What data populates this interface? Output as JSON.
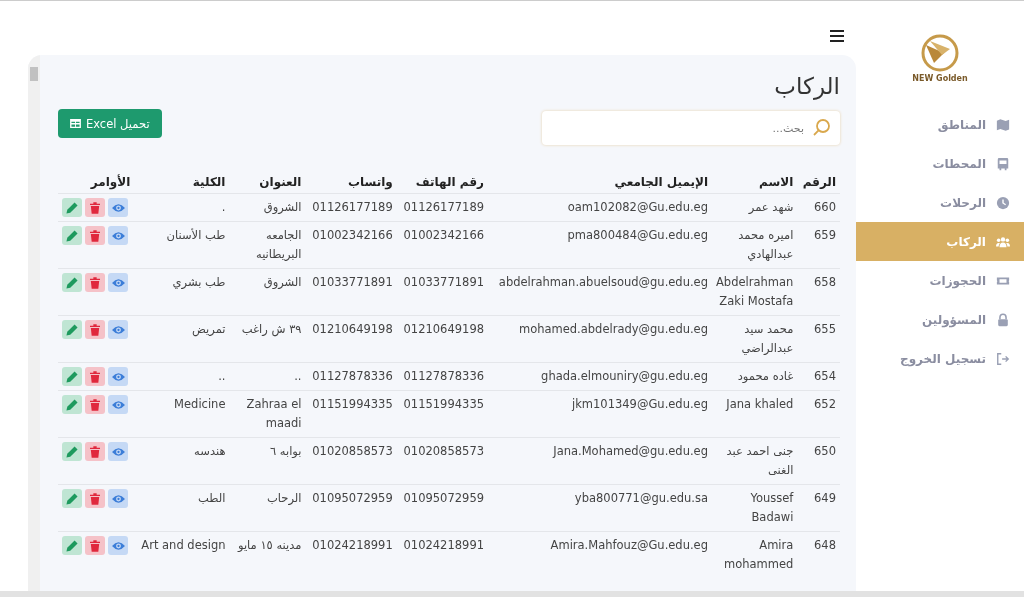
{
  "logo": {
    "text": "NEW Golden"
  },
  "sidebar": {
    "items": [
      {
        "label": "المناطق",
        "selected": false
      },
      {
        "label": "المحطات",
        "selected": false
      },
      {
        "label": "الرحلات",
        "selected": false
      },
      {
        "label": "الركاب",
        "selected": true
      },
      {
        "label": "الحجوزات",
        "selected": false
      },
      {
        "label": "المسؤولين",
        "selected": false
      },
      {
        "label": "تسجيل الخروج",
        "selected": false
      }
    ]
  },
  "page": {
    "title": "الركاب"
  },
  "search": {
    "placeholder": "بحث..."
  },
  "export_button": {
    "label": "تحميل Excel"
  },
  "table": {
    "columns": [
      "الرقم",
      "الاسم",
      "الإيميل الجامعي",
      "رقم الهاتف",
      "واتساب",
      "العنوان",
      "الكلية",
      "الأوامر"
    ],
    "rows": [
      {
        "id": "660",
        "name": "شهد عمر",
        "email": "oam102082@Gu.edu.eg",
        "phone": "01126177189",
        "whatsapp": "01126177189",
        "address": "الشروق",
        "college": "."
      },
      {
        "id": "659",
        "name": "اميره محمد عبدالهادي",
        "email": "pma800484@Gu.edu.eg",
        "phone": "01002342166",
        "whatsapp": "01002342166",
        "address": "الجامعه البريطانيه",
        "college": "طب الأسنان"
      },
      {
        "id": "658",
        "name": "Abdelrahman Zaki Mostafa",
        "email": "abdelrahman.abuelsoud@gu.edu.eg",
        "phone": "01033771891",
        "whatsapp": "01033771891",
        "address": "الشروق",
        "college": "طب بشري"
      },
      {
        "id": "655",
        "name": "محمد سيد عبدالراضي",
        "email": "mohamed.abdelrady@gu.edu.eg",
        "phone": "01210649198",
        "whatsapp": "01210649198",
        "address": "٣٩ ش راغب",
        "college": "تمريض"
      },
      {
        "id": "654",
        "name": "غاده محمود",
        "email": "ghada.elmouniry@gu.edu.eg",
        "phone": "01127878336",
        "whatsapp": "01127878336",
        "address": "..",
        "college": ".."
      },
      {
        "id": "652",
        "name": "Jana khaled",
        "email": "jkm101349@Gu.edu.eg",
        "phone": "01151994335",
        "whatsapp": "01151994335",
        "address": "Zahraa el maadi",
        "college": "Medicine"
      },
      {
        "id": "650",
        "name": "جنى احمد عبد الغنى",
        "email": "Jana.Mohamed@gu.edu.eg",
        "phone": "01020858573",
        "whatsapp": "01020858573",
        "address": "بوابه ٦",
        "college": "هندسه"
      },
      {
        "id": "649",
        "name": "Youssef Badawi",
        "email": "yba800771@gu.edu.sa",
        "phone": "01095072959",
        "whatsapp": "01095072959",
        "address": "الرحاب",
        "college": "الطب"
      },
      {
        "id": "648",
        "name": "Amira mohammed",
        "email": "Amira.Mahfouz@Gu.edu.eg",
        "phone": "01024218991",
        "whatsapp": "01024218991",
        "address": "مدينه ١٥ مايو",
        "college": "Art and design"
      }
    ]
  }
}
